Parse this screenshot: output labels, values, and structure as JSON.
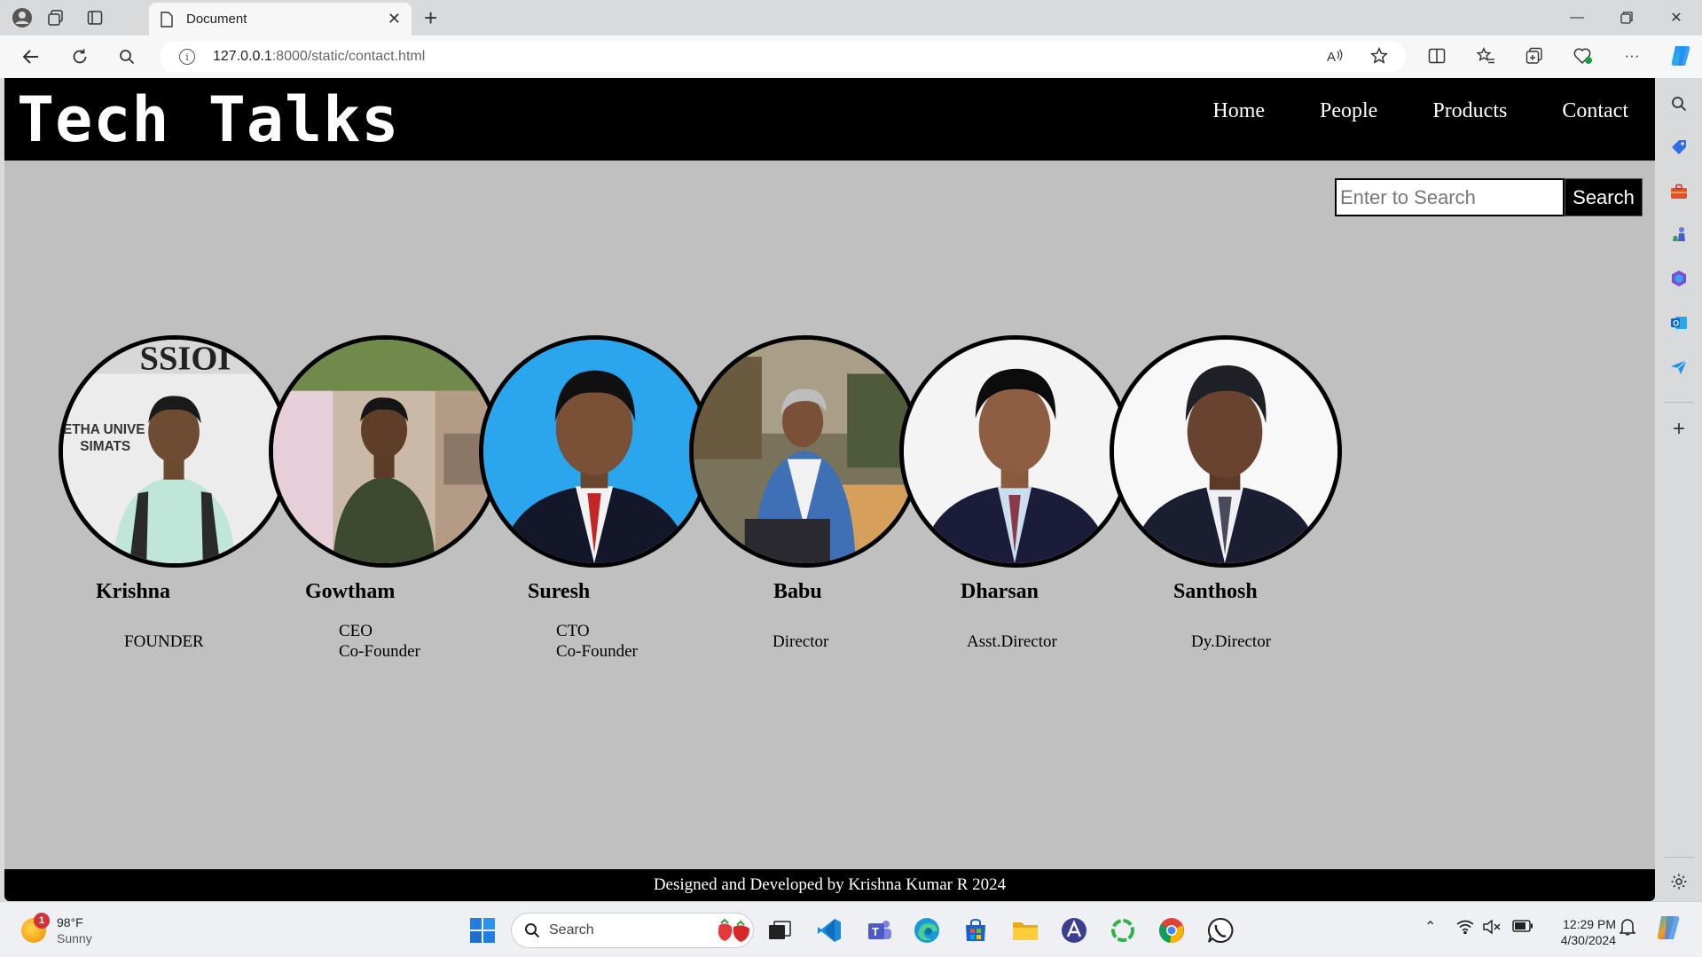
{
  "browser": {
    "tab_title": "Document",
    "url_host": "127.0.0.1",
    "url_path": ":8000/static/contact.html"
  },
  "site": {
    "logo": "Tech Talks",
    "nav": [
      "Home",
      "People",
      "Products",
      "Contact"
    ],
    "search_placeholder": "Enter to Search",
    "search_button": "Search",
    "footer": "Designed and Developed by Krishna Kumar R 2024"
  },
  "people": [
    {
      "name": "Krishna",
      "role": "FOUNDER",
      "bg": "#e8e8e8"
    },
    {
      "name": "Gowtham",
      "role": "CEO\nCo-Founder",
      "bg": "#b8a78f"
    },
    {
      "name": "Suresh",
      "role": "CTO\nCo-Founder",
      "bg": "#29a8ef"
    },
    {
      "name": "Babu",
      "role": "Director",
      "bg": "#6f6a55"
    },
    {
      "name": "Dharsan",
      "role": "Asst.Director",
      "bg": "#f4f4f4"
    },
    {
      "name": "Santhosh",
      "role": "Dy.Director",
      "bg": "#f8f8f8"
    }
  ],
  "photo_texts": {
    "krishna_banner_1": "ETHA UNIVE",
    "krishna_banner_2": "SIMATS",
    "krishna_banner_top": "SSIOI"
  },
  "taskbar": {
    "temp": "98°F",
    "condition": "Sunny",
    "weather_badge": "1",
    "search_label": "Search",
    "time": "12:29 PM",
    "date": "4/30/2024"
  }
}
